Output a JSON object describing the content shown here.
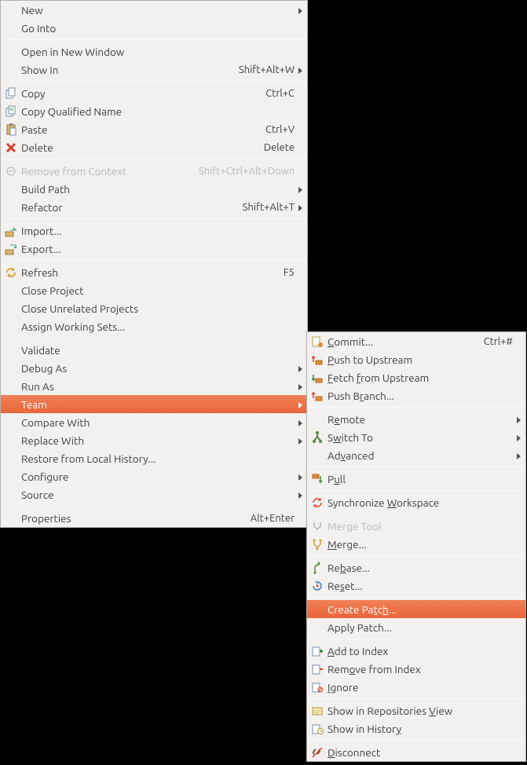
{
  "main_menu": {
    "groups": [
      [
        {
          "id": "new",
          "label": "New",
          "submenu": true
        },
        {
          "id": "go-into",
          "label": "Go Into"
        }
      ],
      [
        {
          "id": "open-new-window",
          "label": "Open in New Window"
        },
        {
          "id": "show-in",
          "label": "Show In",
          "accel": "Shift+Alt+W",
          "submenu": true
        }
      ],
      [
        {
          "id": "copy",
          "label": "Copy",
          "accel": "Ctrl+C",
          "icon": "copy"
        },
        {
          "id": "copy-qualified",
          "label": "Copy Qualified Name",
          "icon": "copy-qualified"
        },
        {
          "id": "paste",
          "label": "Paste",
          "accel": "Ctrl+V",
          "icon": "paste"
        },
        {
          "id": "delete",
          "label": "Delete",
          "accel": "Delete",
          "icon": "delete"
        }
      ],
      [
        {
          "id": "remove-context",
          "label": "Remove from Context",
          "accel": "Shift+Ctrl+Alt+Down",
          "icon": "remove-context",
          "disabled": true
        },
        {
          "id": "build-path",
          "label": "Build Path",
          "submenu": true
        },
        {
          "id": "refactor",
          "label": "Refactor",
          "accel": "Shift+Alt+T",
          "submenu": true
        }
      ],
      [
        {
          "id": "import",
          "label": "Import...",
          "icon": "import"
        },
        {
          "id": "export",
          "label": "Export...",
          "icon": "export"
        }
      ],
      [
        {
          "id": "refresh",
          "label": "Refresh",
          "accel": "F5",
          "icon": "refresh"
        },
        {
          "id": "close-project",
          "label": "Close Project"
        },
        {
          "id": "close-unrelated",
          "label": "Close Unrelated Projects"
        },
        {
          "id": "assign-working-sets",
          "label": "Assign Working Sets..."
        }
      ],
      [
        {
          "id": "validate",
          "label": "Validate"
        },
        {
          "id": "debug-as",
          "label": "Debug As",
          "submenu": true
        },
        {
          "id": "run-as",
          "label": "Run As",
          "submenu": true
        },
        {
          "id": "team",
          "label": "Team",
          "submenu": true,
          "highlight": true
        },
        {
          "id": "compare-with",
          "label": "Compare With",
          "submenu": true
        },
        {
          "id": "replace-with",
          "label": "Replace With",
          "submenu": true
        },
        {
          "id": "restore-local",
          "label": "Restore from Local History..."
        },
        {
          "id": "configure",
          "label": "Configure",
          "submenu": true
        },
        {
          "id": "source",
          "label": "Source",
          "submenu": true
        }
      ],
      [
        {
          "id": "properties",
          "label": "Properties",
          "accel": "Alt+Enter"
        }
      ]
    ]
  },
  "sub_menu": {
    "groups": [
      [
        {
          "id": "commit",
          "label": "<u>C</u>ommit...",
          "accel": "Ctrl+#",
          "icon": "commit"
        },
        {
          "id": "push-upstream",
          "label": "<u>P</u>ush to Upstream",
          "icon": "push"
        },
        {
          "id": "fetch-upstream",
          "label": "<u>F</u>etch <u>f</u>rom Upstream",
          "icon": "fetch"
        },
        {
          "id": "push-branch",
          "label": "Push B<u>r</u>anch...",
          "icon": "push"
        }
      ],
      [
        {
          "id": "remote",
          "label": "R<u>e</u>mote",
          "submenu": true
        },
        {
          "id": "switch-to",
          "label": "S<u>w</u>itch To",
          "submenu": true,
          "icon": "branches"
        },
        {
          "id": "advanced",
          "label": "Ad<u>v</u>anced",
          "submenu": true
        }
      ],
      [
        {
          "id": "pull",
          "label": "P<u>u</u>ll",
          "icon": "pull"
        }
      ],
      [
        {
          "id": "sync-workspace",
          "label": "Synchronize <u>W</u>orkspace",
          "icon": "sync"
        }
      ],
      [
        {
          "id": "merge-tool",
          "label": "Merge Tool",
          "icon": "merge-tool",
          "disabled": true
        },
        {
          "id": "merge",
          "label": "<u>M</u>erge...",
          "icon": "merge"
        }
      ],
      [
        {
          "id": "rebase",
          "label": "Re<u>b</u>ase...",
          "icon": "rebase"
        },
        {
          "id": "reset",
          "label": "Re<u>s</u>et...",
          "icon": "reset"
        }
      ],
      [
        {
          "id": "create-patch",
          "label": "Create Pa<u>t</u>c<u>h</u>...",
          "highlight": true
        },
        {
          "id": "apply-patch",
          "label": "Apply Patch..."
        }
      ],
      [
        {
          "id": "add-index",
          "label": "<u>A</u>dd to Index",
          "icon": "add-index"
        },
        {
          "id": "remove-index",
          "label": "Rem<u>o</u>ve from Index",
          "icon": "remove-index"
        },
        {
          "id": "ignore",
          "label": "<u>I</u>gnore",
          "icon": "ignore"
        }
      ],
      [
        {
          "id": "show-repo-view",
          "label": "Show in Repositories <u>V</u>iew",
          "icon": "repo-view"
        },
        {
          "id": "show-history",
          "label": "Show in Histor<u>y</u>",
          "icon": "history"
        }
      ],
      [
        {
          "id": "disconnect",
          "label": "<u>D</u>isconnect",
          "icon": "disconnect"
        }
      ]
    ]
  }
}
